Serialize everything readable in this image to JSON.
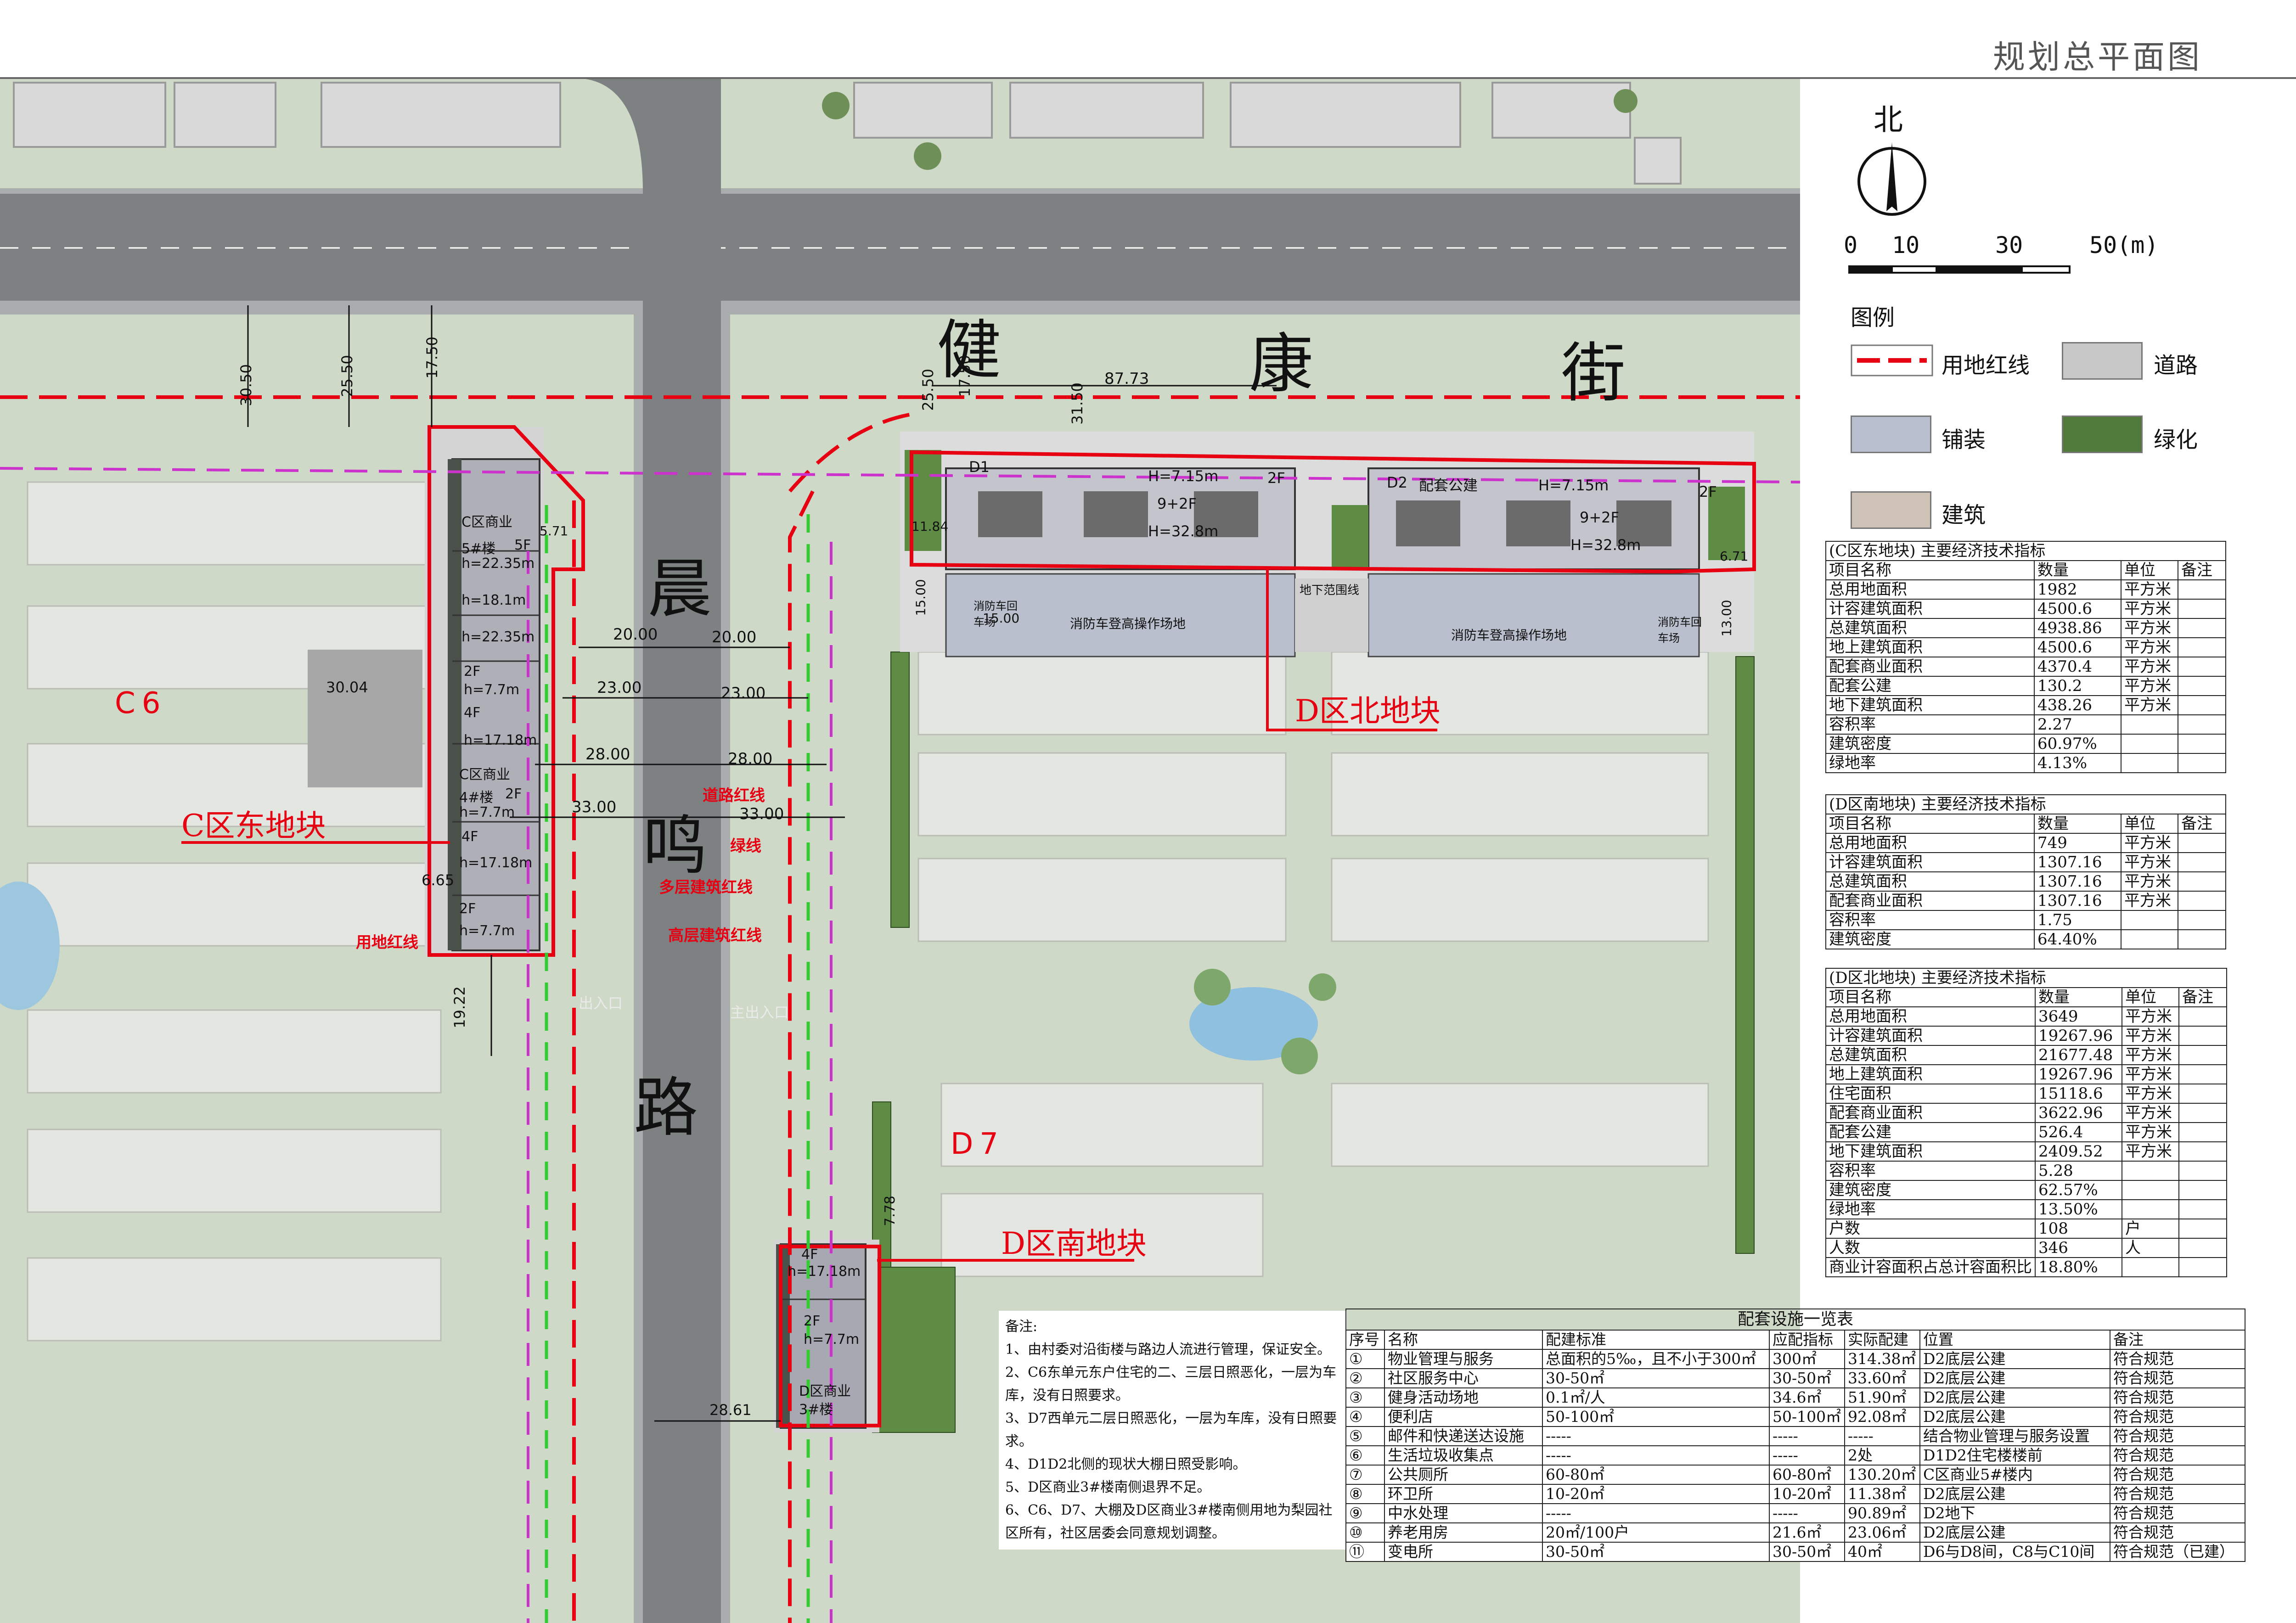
{
  "page_title": "规划总平面图",
  "north": {
    "label": "北"
  },
  "scale": {
    "ticks": [
      "0",
      "10",
      "30",
      "50(m)"
    ]
  },
  "legend": {
    "title": "图例",
    "items": [
      {
        "label": "用地红线",
        "color": "#e60012"
      },
      {
        "label": "道路",
        "color": "#c8c8c8"
      },
      {
        "label": "铺装",
        "color": "#b8c0d0"
      },
      {
        "label": "绿化",
        "color": "#4f7a3c"
      },
      {
        "label": "建筑",
        "color": "#cfc3b8"
      }
    ]
  },
  "map": {
    "road_names": {
      "jian": "健",
      "kang": "康",
      "jie": "街",
      "chen": "晨",
      "ming": "鸣",
      "lu": "路"
    },
    "zone_labels": {
      "c6": "C6",
      "d7": "D7"
    },
    "parcel_labels": {
      "c_east": "C区东地块",
      "d_north": "D区北地块",
      "d_south": "D区南地块"
    },
    "line_labels": {
      "road_red": "道路红线",
      "green": "绿线",
      "multi": "多层建筑红线",
      "high": "高层建筑红线",
      "land": "用地红线"
    },
    "dims": {
      "d3050": "30.50",
      "d2550": "25.50",
      "d1750": "17.50",
      "d2550b": "25.50",
      "d1750b": "17.50",
      "d3150": "31.50",
      "d8773": "87.73",
      "d2000a": "20.00",
      "d2000b": "20.00",
      "d2300a": "23.00",
      "d2300b": "23.00",
      "d2800a": "28.00",
      "d2800b": "28.00",
      "d3300a": "33.00",
      "d3300b": "33.00",
      "d3004": "30.04",
      "d665": "6.65",
      "d1922": "19.22",
      "d2861": "28.61",
      "d778": "7.78",
      "d1500a": "15.00",
      "d1500b": "15.00",
      "d1500c": "13.00",
      "d571": "5.71",
      "d677": "6.71",
      "d1184": "11.84"
    },
    "buildings": {
      "c5_name": "C区商业",
      "c5_no": "5#楼",
      "c5_fl": "5F",
      "c5_h": "h=22.35m",
      "c_h181": "h=18.1m",
      "c_h2235": "h=22.35m",
      "c_2f": "2F",
      "c_h77": "h=7.7m",
      "c_4f": "4F",
      "c_h1718": "h=17.18m",
      "c4_name": "C区商业",
      "c4_no": "4#楼",
      "c4_2f": "2F",
      "c4_h": "h=7.7m",
      "c_4f2": "4F",
      "c_h1718b": "h=17.18m",
      "c_2f3": "2F",
      "c_h77c": "h=7.7m",
      "d1": "D1",
      "d1_h": "H=7.15m",
      "d1_2f": "2F",
      "d1_9": "9+2F",
      "d1_h2": "H=32.8m",
      "d2": "D2",
      "d2_name": "配套公建",
      "d2_h": "H=7.15m",
      "d2_9": "9+2F",
      "d2_h2": "H=32.8m",
      "d2_2f": "2F",
      "fire1": "消防车登高操作场地",
      "fire2": "消防车登高操作场地",
      "turn1": "消防车回车场",
      "turn2": "消防车回车场",
      "basement": "地下范围线",
      "s_4f": "4F",
      "s_h1718": "h=17.18m",
      "s_2f": "2F",
      "s_h77": "h=7.7m",
      "s_name": "D区商业",
      "s_no": "3#楼",
      "entry1": "出入口",
      "entry2": "主出入口"
    }
  },
  "tables": [
    {
      "title": "(C区东地块) 主要经济技术指标",
      "header": [
        "项目名称",
        "数量",
        "单位",
        "备注"
      ],
      "rows": [
        [
          "总用地面积",
          "1982",
          "平方米",
          ""
        ],
        [
          "计容建筑面积",
          "4500.6",
          "平方米",
          ""
        ],
        [
          "总建筑面积",
          "4938.86",
          "平方米",
          ""
        ],
        [
          "地上建筑面积",
          "4500.6",
          "平方米",
          ""
        ],
        [
          "    配套商业面积",
          "4370.4",
          "平方米",
          ""
        ],
        [
          "    配套公建",
          "130.2",
          "平方米",
          ""
        ],
        [
          "地下建筑面积",
          "438.26",
          "平方米",
          ""
        ],
        [
          "容积率",
          "2.27",
          "",
          ""
        ],
        [
          "建筑密度",
          "60.97%",
          "",
          ""
        ],
        [
          "绿地率",
          "4.13%",
          "",
          ""
        ]
      ]
    },
    {
      "title": "(D区南地块) 主要经济技术指标",
      "header": [
        "项目名称",
        "数量",
        "单位",
        "备注"
      ],
      "rows": [
        [
          "总用地面积",
          "749",
          "平方米",
          ""
        ],
        [
          "计容建筑面积",
          "1307.16",
          "平方米",
          ""
        ],
        [
          "总建筑面积",
          "1307.16",
          "平方米",
          ""
        ],
        [
          "    配套商业面积",
          "1307.16",
          "平方米",
          ""
        ],
        [
          "容积率",
          "1.75",
          "",
          ""
        ],
        [
          "建筑密度",
          "64.40%",
          "",
          ""
        ]
      ]
    },
    {
      "title": "(D区北地块) 主要经济技术指标",
      "header": [
        "项目名称",
        "数量",
        "单位",
        "备注"
      ],
      "rows": [
        [
          "总用地面积",
          "3649",
          "平方米",
          ""
        ],
        [
          "计容建筑面积",
          "19267.96",
          "平方米",
          ""
        ],
        [
          "总建筑面积",
          "21677.48",
          "平方米",
          ""
        ],
        [
          "地上建筑面积",
          "19267.96",
          "平方米",
          ""
        ],
        [
          "    住宅面积",
          "15118.6",
          "平方米",
          ""
        ],
        [
          "    配套商业面积",
          "3622.96",
          "平方米",
          ""
        ],
        [
          "    配套公建",
          "526.4",
          "平方米",
          ""
        ],
        [
          "地下建筑面积",
          "2409.52",
          "平方米",
          ""
        ],
        [
          "容积率",
          "5.28",
          "",
          ""
        ],
        [
          "建筑密度",
          "62.57%",
          "",
          ""
        ],
        [
          "绿地率",
          "13.50%",
          "",
          ""
        ],
        [
          "户数",
          "108",
          "户",
          ""
        ],
        [
          "人数",
          "346",
          "人",
          ""
        ],
        [
          "商业计容面积占总计容面积比",
          "18.80%",
          "",
          ""
        ]
      ]
    }
  ],
  "facilities": {
    "title": "配套设施一览表",
    "header": [
      "序号",
      "名称",
      "配建标准",
      "应配指标",
      "实际配建",
      "位置",
      "备注"
    ],
    "rows": [
      [
        "①",
        "物业管理与服务",
        "总面积的5‰，且不小于300㎡",
        "300㎡",
        "314.38㎡",
        "D2底层公建",
        "符合规范"
      ],
      [
        "②",
        "社区服务中心",
        "30-50㎡",
        "30-50㎡",
        "33.60㎡",
        "D2底层公建",
        "符合规范"
      ],
      [
        "③",
        "健身活动场地",
        "0.1㎡/人",
        "34.6㎡",
        "51.90㎡",
        "D2底层公建",
        "符合规范"
      ],
      [
        "④",
        "便利店",
        "50-100㎡",
        "50-100㎡",
        "92.08㎡",
        "D2底层公建",
        "符合规范"
      ],
      [
        "⑤",
        "邮件和快递送达设施",
        "-----",
        "-----",
        "-----",
        "结合物业管理与服务设置",
        "符合规范"
      ],
      [
        "⑥",
        "生活垃圾收集点",
        "-----",
        "-----",
        "2处",
        "D1D2住宅楼楼前",
        "符合规范"
      ],
      [
        "⑦",
        "公共厕所",
        "60-80㎡",
        "60-80㎡",
        "130.20㎡",
        "C区商业5#楼内",
        "符合规范"
      ],
      [
        "⑧",
        "环卫所",
        "10-20㎡",
        "10-20㎡",
        "11.38㎡",
        "D2底层公建",
        "符合规范"
      ],
      [
        "⑨",
        "中水处理",
        "-----",
        "-----",
        "90.89㎡",
        "D2地下",
        "符合规范"
      ],
      [
        "⑩",
        "养老用房",
        "20㎡/100户",
        "21.6㎡",
        "23.06㎡",
        "D2底层公建",
        "符合规范"
      ],
      [
        "⑪",
        "变电所",
        "30-50㎡",
        "30-50㎡",
        "40㎡",
        "D6与D8间，C8与C10间",
        "符合规范（已建）"
      ]
    ]
  },
  "notes": {
    "title": "备注:",
    "items": [
      "1、由村委对沿街楼与路边人流进行管理，保证安全。",
      "2、C6东单元东户住宅的二、三层日照恶化，一层为车库，没有日照要求。",
      "3、D7西单元二层日照恶化，一层为车库，没有日照要求。",
      "4、D1D2北侧的现状大棚日照受影响。",
      "5、D区商业3#楼南侧退界不足。",
      "6、C6、D7、大棚及D区商业3#楼南侧用地为梨园社区所有，社区居委会同意规划调整。"
    ]
  }
}
